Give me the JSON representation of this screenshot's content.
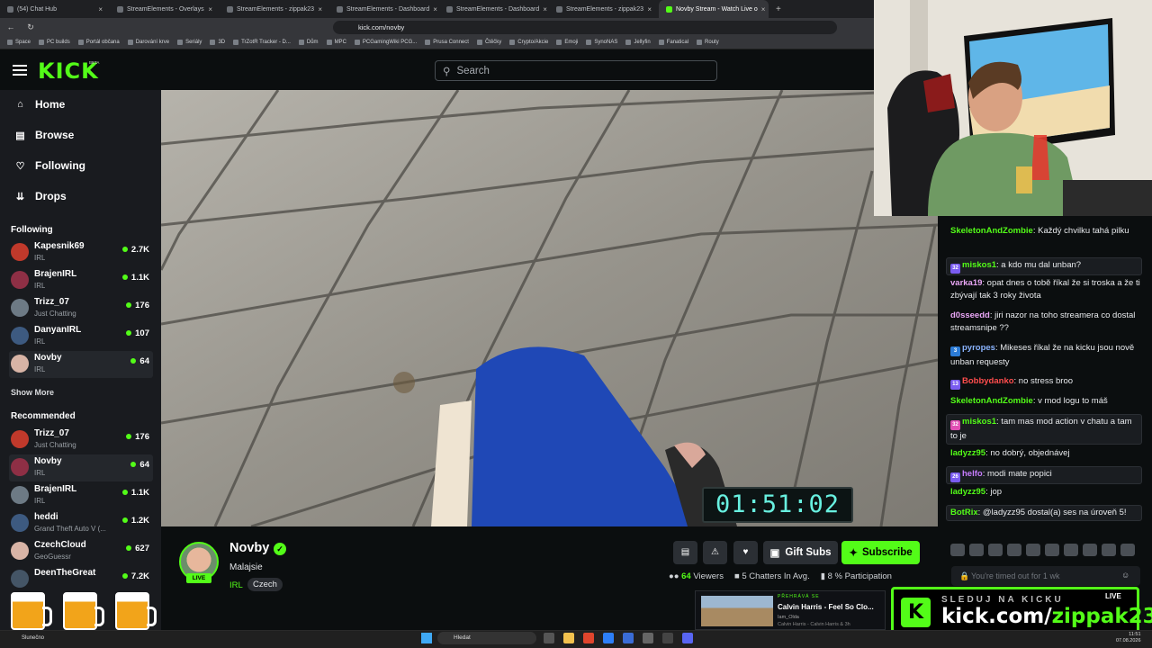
{
  "browser": {
    "tabs": [
      {
        "title": "(54) Chat Hub",
        "active": false
      },
      {
        "title": "StreamElements - Overlays",
        "active": false
      },
      {
        "title": "StreamElements - zippak23",
        "active": false
      },
      {
        "title": "StreamElements - Dashboard",
        "active": false
      },
      {
        "title": "StreamElements - Dashboard",
        "active": false
      },
      {
        "title": "StreamElements - zippak23",
        "active": false
      },
      {
        "title": "Novby Stream - Watch Live o",
        "active": true
      }
    ],
    "url": "kick.com/novby",
    "bookmarks": [
      "Space",
      "PC builds",
      "Portál občana",
      "Darování krve",
      "Seriály",
      "3D",
      "TrZotR Tracker - D...",
      "Dům",
      "MPC",
      "PCGamingWiki PCG...",
      "Prusa Connect",
      "Čtěčky",
      "Crypto/Akcie",
      "Emoji",
      "SynoNAS",
      "Jellyfin",
      "Fanatical",
      "Routy"
    ]
  },
  "header": {
    "logo": "KICK",
    "logo_badge": "BETA",
    "search_placeholder": "Search"
  },
  "sidebar": {
    "nav": [
      {
        "label": "Home",
        "icon": "home-icon"
      },
      {
        "label": "Browse",
        "icon": "browse-icon"
      },
      {
        "label": "Following",
        "icon": "heart-icon"
      },
      {
        "label": "Drops",
        "icon": "drops-icon"
      }
    ],
    "following_title": "Following",
    "following": [
      {
        "name": "Kapesnik69",
        "category": "IRL",
        "viewers": "2.7K"
      },
      {
        "name": "BrajenIRL",
        "category": "IRL",
        "viewers": "1.1K"
      },
      {
        "name": "Trizz_07",
        "category": "Just Chatting",
        "viewers": "176"
      },
      {
        "name": "DanyanIRL",
        "category": "IRL",
        "viewers": "107"
      },
      {
        "name": "Novby",
        "category": "IRL",
        "viewers": "64"
      }
    ],
    "show_more": "Show More",
    "recommended_title": "Recommended",
    "recommended": [
      {
        "name": "Trizz_07",
        "category": "Just Chatting",
        "viewers": "176"
      },
      {
        "name": "Novby",
        "category": "IRL",
        "viewers": "64"
      },
      {
        "name": "BrajenIRL",
        "category": "IRL",
        "viewers": "1.1K"
      },
      {
        "name": "heddi",
        "category": "Grand Theft Auto V (...",
        "viewers": "1.2K"
      },
      {
        "name": "CzechCloud",
        "category": "GeoGuessr",
        "viewers": "627"
      },
      {
        "name": "DeenTheGreat",
        "category": "",
        "viewers": "7.2K"
      }
    ]
  },
  "video": {
    "timer": "01:51:02"
  },
  "stream": {
    "live_badge": "LIVE",
    "streamer": "Novby",
    "title": "Malajsie",
    "category": "IRL",
    "tag": "Czech",
    "gift_subs": "Gift Subs",
    "subscribe": "Subscribe",
    "viewers": "64",
    "viewers_label": "Viewers",
    "chatters": "5",
    "chatters_label": "Chatters In Avg.",
    "participation": "8",
    "participation_label": "% Participation"
  },
  "chat": {
    "messages": [
      {
        "user": "SkeletonAndZombie",
        "color": "#53fc18",
        "text": ": Každý chvilku tahá pilku"
      },
      {
        "user": "miskos1",
        "color": "#53fc18",
        "text": ": a kdo mu dal unban?",
        "badge": "32"
      },
      {
        "user": "varka19",
        "color": "#e9a6f5",
        "text": ": opat dnes o tobě říkal že si troska a že ti zbývají tak 3 roky života"
      },
      {
        "user": "d0sseedd",
        "color": "#e9a6f5",
        "text": ": jiri nazor na toho streamera co dostal streamsnipe ??"
      },
      {
        "user": "pyropes",
        "color": "#8ab4ff",
        "text": ": Mikeses říkal že na kicku jsou nově unban requesty",
        "badge": "3"
      },
      {
        "user": "Bobbydanko",
        "color": "#ff4d4d",
        "text": ": no stress broo",
        "badge": "13"
      },
      {
        "user": "SkeletonAndZombie",
        "color": "#53fc18",
        "text": ": v mod logu to máš"
      },
      {
        "user": "miskos1",
        "color": "#53fc18",
        "text": ": tam mas mod action v chatu a tam to je",
        "badge": "32"
      },
      {
        "user": "ladyzz95",
        "color": "#53fc18",
        "text": ": no dobrý, objednávej"
      },
      {
        "user": "helfo",
        "color": "#c77dff",
        "text": ": modi mate popici",
        "badge": "26"
      },
      {
        "user": "ladyzz95",
        "color": "#53fc18",
        "text": ": jop"
      },
      {
        "user": "BotRix",
        "color": "#53fc18",
        "text": ": @ladyzz95 dostal(a) ses na úroveň 5!"
      }
    ],
    "input_placeholder": "You're timed out for 1 wk"
  },
  "overlays": {
    "music_label": "PŘEHRÁVÁ SE",
    "music_title": "Calvin Harris - Feel So Clo...",
    "music_by": "Iam_Olda",
    "music_track": "Calvin Harris - Calvin Harris & 3h",
    "promo_top": "SLEDUJ NA KICKU",
    "promo_url_a": "kick.com/",
    "promo_url_b": "zippak23",
    "promo_live": "LIVE"
  },
  "taskbar": {
    "weather": "Slunečno",
    "search": "Hledat",
    "time": "11:51",
    "date": "07.08.2026"
  }
}
